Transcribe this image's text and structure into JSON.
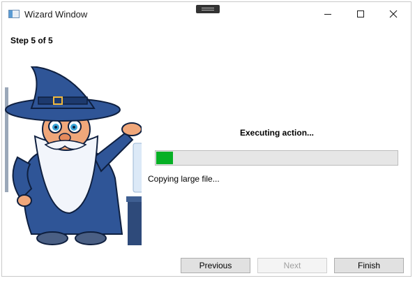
{
  "window": {
    "title": "Wizard Window",
    "title_icon": "app-window-icon",
    "controls": {
      "minimize_icon": "minimize-icon",
      "maximize_icon": "maximize-icon",
      "close_icon": "close-icon",
      "close_glyph": "✕"
    }
  },
  "wizard": {
    "step_label": "Step 5 of 5",
    "action_label": "Executing action...",
    "progress_fraction": 0.07,
    "progress_color": "#06b025",
    "status_text": "Copying large file...",
    "illustration": "wizard-character-illustration"
  },
  "buttons": {
    "previous": {
      "label": "Previous",
      "enabled": true
    },
    "next": {
      "label": "Next",
      "enabled": false
    },
    "finish": {
      "label": "Finish",
      "enabled": true
    }
  }
}
